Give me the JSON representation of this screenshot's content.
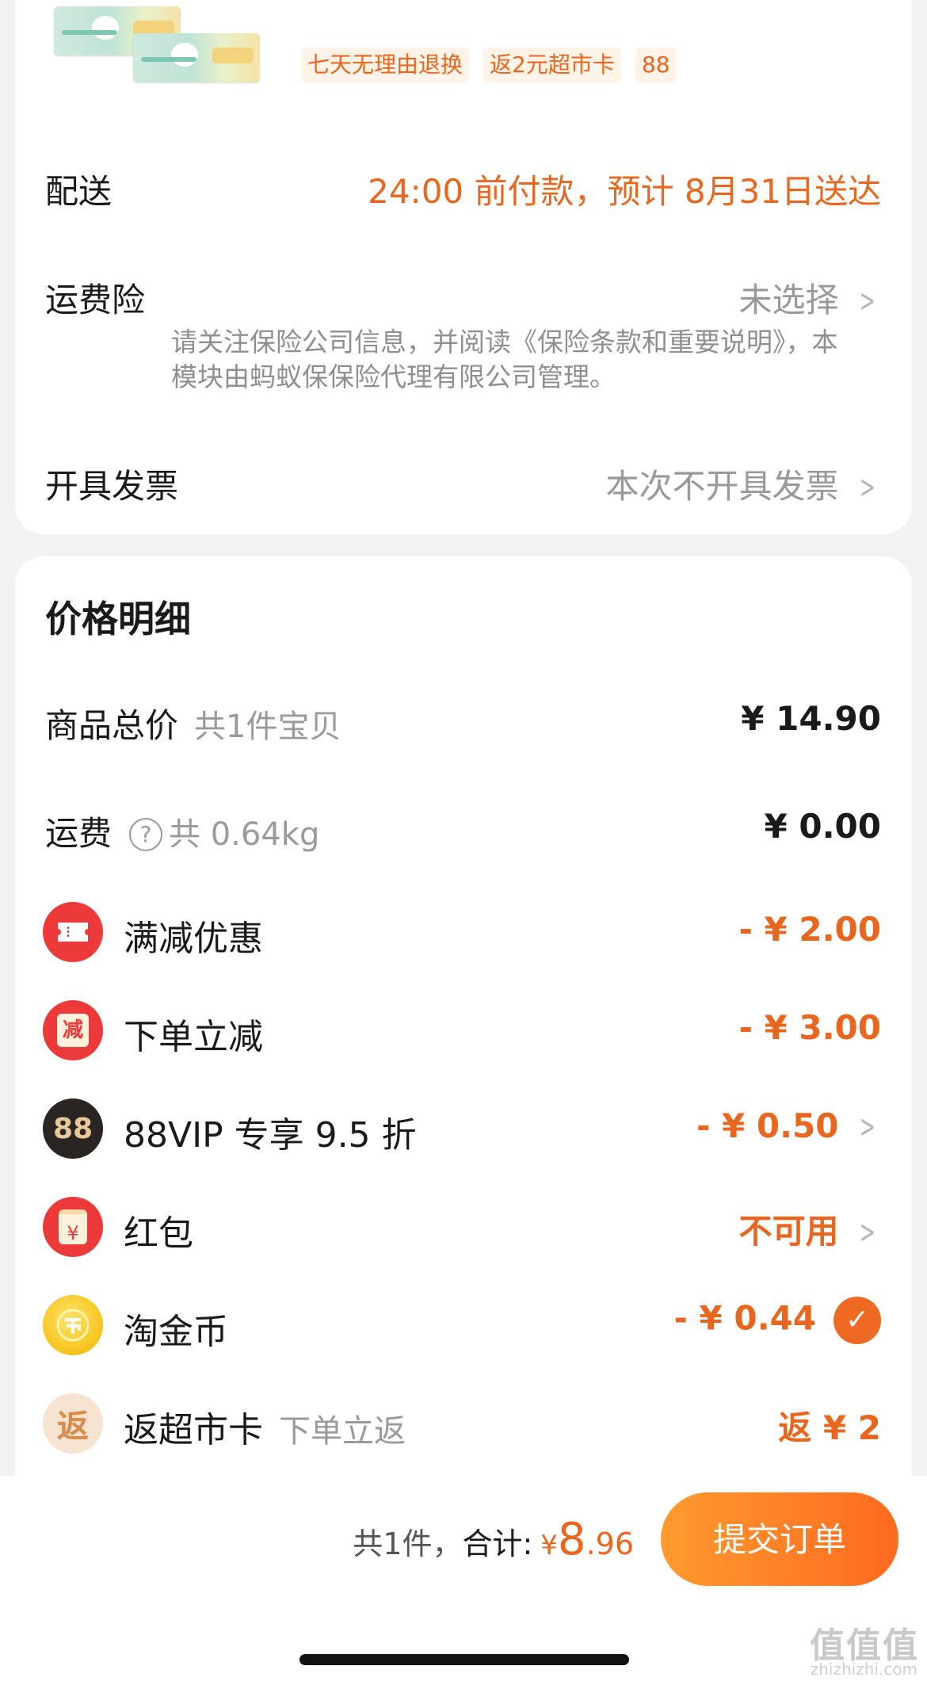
{
  "product": {
    "tags": [
      "七天无理由退换",
      "返2元超市卡",
      "88"
    ]
  },
  "order_info": {
    "delivery": {
      "label": "配送",
      "value": "24:00 前付款，预计 8月31日送达"
    },
    "insurance": {
      "label": "运费险",
      "value": "未选择",
      "note": "请关注保险公司信息，并阅读《保险条款和重要说明》，本模块由蚂蚁保保险代理有限公司管理。"
    },
    "invoice": {
      "label": "开具发票",
      "value": "本次不开具发票"
    }
  },
  "price_detail": {
    "title": "价格明细",
    "goods_total": {
      "label": "商品总价",
      "sub": "共1件宝贝",
      "value": "¥ 14.90"
    },
    "shipping": {
      "label": "运费",
      "help_icon": "?",
      "sub": "共 0.64kg",
      "value": "¥ 0.00"
    },
    "discounts": [
      {
        "icon": "ticket-icon",
        "label": "满减优惠",
        "value": "- ¥ 2.00",
        "chevron": false
      },
      {
        "icon": "reduce-icon",
        "icon_text": "减",
        "label": "下单立减",
        "value": "- ¥ 3.00",
        "chevron": false
      },
      {
        "icon": "vip88-icon",
        "icon_text": "88",
        "label": "88VIP 专享 9.5 折",
        "value": "- ¥ 0.50",
        "chevron": true
      },
      {
        "icon": "red-packet-icon",
        "icon_text": "¥",
        "label": "红包",
        "value": "不可用",
        "chevron": true
      },
      {
        "icon": "gold-coin-icon",
        "label": "淘金币",
        "value": "- ¥ 0.44",
        "checked": true
      },
      {
        "icon": "rebate-icon",
        "icon_text": "返",
        "label": "返超市卡",
        "sub": "下单立返",
        "value": "返 ¥ 2"
      }
    ]
  },
  "footer": {
    "count_text": "共1件，",
    "total_label": "合计:",
    "currency": "¥",
    "total_int": "8",
    "total_dec": ".96",
    "submit_label": "提交订单"
  },
  "watermark": {
    "text": "值值值",
    "sub": "zhizhizhi.com"
  },
  "colors": {
    "accent": "#e9661f",
    "button_start": "#ff9a2f",
    "button_end": "#ff6a1f"
  }
}
